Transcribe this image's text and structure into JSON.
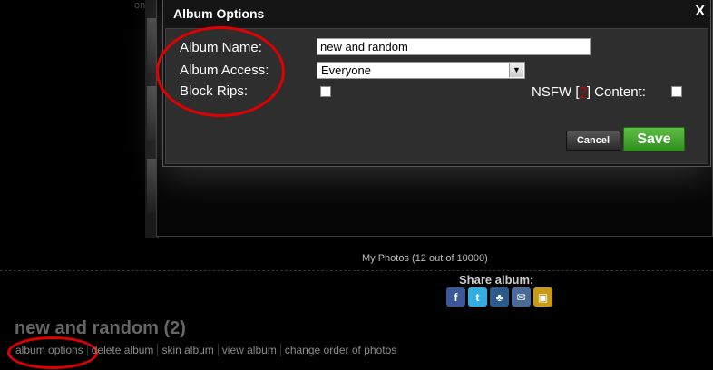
{
  "background": {
    "username_fragment": "ony.",
    "my_photos": "My Photos (12 out of 10000)",
    "share_title": "Share album:",
    "share_icons": [
      "facebook-icon",
      "twitter-icon",
      "myspace-icon",
      "email-icon",
      "embed-icon"
    ],
    "album_title": "new and random (2)",
    "album_links": [
      "album options",
      "delete album",
      "skin album",
      "view album",
      "change order of photos"
    ]
  },
  "modal": {
    "title": "Album Options",
    "close_label": "X",
    "album_name_label": "Album Name:",
    "album_name_value": "new and random",
    "album_access_label": "Album Access:",
    "album_access_value": "Everyone",
    "block_rips_label": "Block Rips:",
    "nsfw_prefix": "NSFW [",
    "nsfw_mark": "?",
    "nsfw_suffix": "] Content:",
    "cancel_label": "Cancel",
    "save_label": "Save"
  },
  "colors": {
    "accent_green": "#3aa028",
    "annotation_red": "#e00000"
  }
}
